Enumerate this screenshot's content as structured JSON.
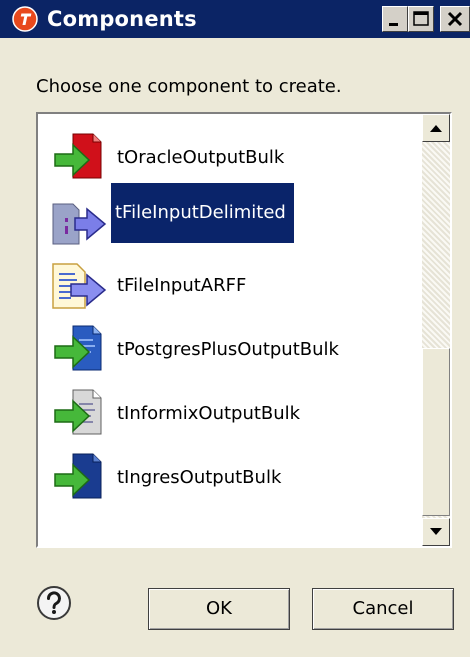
{
  "window": {
    "title": "Components",
    "minimize_label": "_",
    "maximize_label": "□",
    "close_label": "×"
  },
  "prompt": "Choose one component to create.",
  "components": [
    {
      "name": "tOracleOutputBulk",
      "icon": "oracle-output-bulk-icon",
      "selected": false
    },
    {
      "name": "tFileInputDelimited",
      "icon": "file-input-delimited-icon",
      "selected": true
    },
    {
      "name": "tFileInputARFF",
      "icon": "file-input-arff-icon",
      "selected": false
    },
    {
      "name": "tPostgresPlusOutputBulk",
      "icon": "postgresplus-output-bulk-icon",
      "selected": false
    },
    {
      "name": "tInformixOutputBulk",
      "icon": "informix-output-bulk-icon",
      "selected": false
    },
    {
      "name": "tIngresOutputBulk",
      "icon": "ingres-output-bulk-icon",
      "selected": false
    }
  ],
  "buttons": {
    "help_icon": "question-mark-icon",
    "ok_label": "OK",
    "cancel_label": "Cancel"
  },
  "colors": {
    "titlebar": "#0b2465",
    "selection": "#0a246a",
    "dialog_bg": "#ece9d8"
  }
}
